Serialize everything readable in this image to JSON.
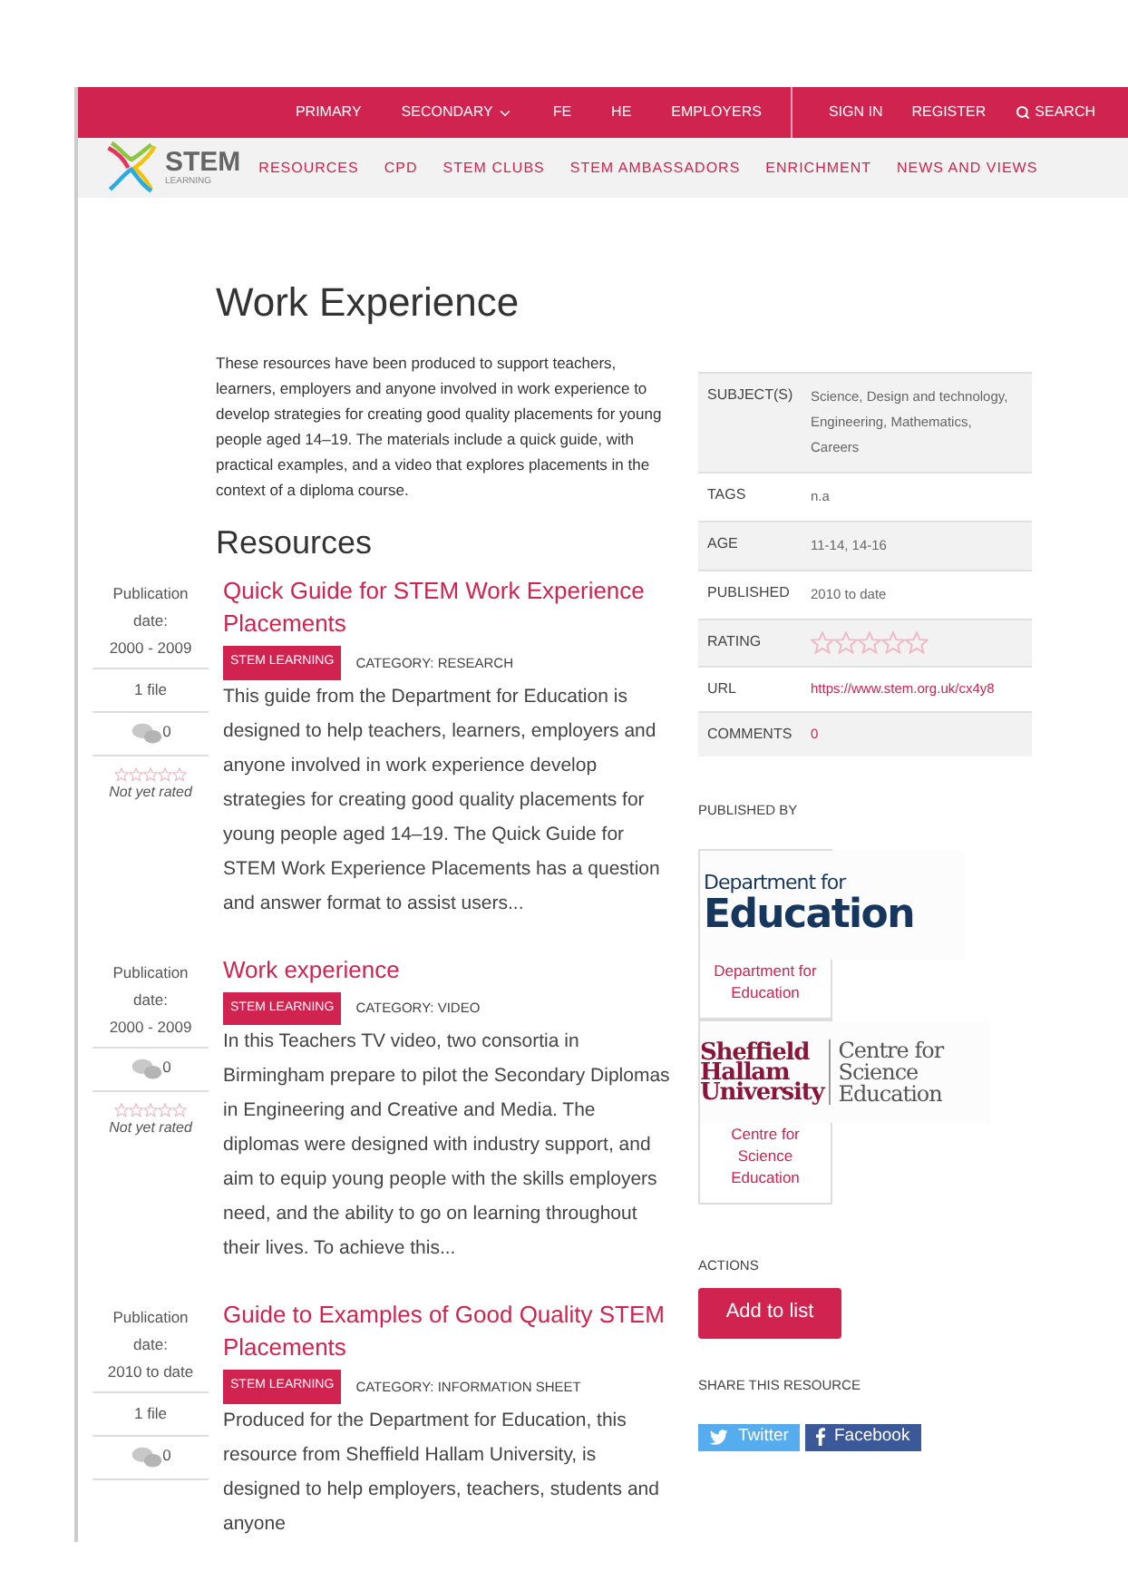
{
  "top_bar": {
    "links": [
      {
        "label": "PRIMARY",
        "dropdown": false
      },
      {
        "label": "SECONDARY",
        "dropdown": true
      },
      {
        "label": "FE",
        "dropdown": false
      },
      {
        "label": "HE",
        "dropdown": false
      },
      {
        "label": "EMPLOYERS",
        "dropdown": false
      }
    ],
    "account_links": [
      "SIGN IN",
      "REGISTER"
    ],
    "search": "SEARCH"
  },
  "logo": {
    "name": "STEM",
    "sub": "LEARNING"
  },
  "main_nav": [
    "RESOURCES",
    "CPD",
    "STEM CLUBS",
    "STEM AMBASSADORS",
    "ENRICHMENT",
    "NEWS AND VIEWS"
  ],
  "page_title": "Work Experience",
  "intro": "These resources have been produced to support teachers, learners, employers and anyone involved in work experience to develop strategies for creating good quality placements for young people aged 14–19. The materials include a quick guide, with practical examples, and a video that explores placements in the context of a diploma course.",
  "resources_heading": "Resources",
  "resources": [
    {
      "date_label": "Publication date:",
      "date": "2000 - 2009",
      "files": "1 file",
      "comments": "0",
      "stars": 0,
      "rating_text": "Not yet rated",
      "title": "Quick Guide for STEM Work Experience Placements",
      "badge": "STEM LEARNING",
      "category": "CATEGORY: RESEARCH",
      "description": "This guide from the Department for Education is designed to help teachers, learners, employers and anyone involved in work experience develop strategies for creating good quality placements for young people aged 14–19. The Quick Guide for STEM Work Experience Placements has a question and answer format to assist users..."
    },
    {
      "date_label": "Publication date:",
      "date": "2000 - 2009",
      "comments": "0",
      "stars": 0,
      "rating_text": "Not yet rated",
      "title": "Work experience",
      "badge": "STEM LEARNING",
      "category": "CATEGORY: VIDEO",
      "description": "In this Teachers TV video, two consortia in Birmingham prepare to pilot the Secondary Diplomas in Engineering and Creative and Media. The diplomas were designed with industry support, and aim to equip young people with the skills employers need, and the ability to go on learning throughout their lives. To achieve this..."
    },
    {
      "date_label": "Publication date:",
      "date": "2010 to date",
      "files": "1 file",
      "comments": "0",
      "title": "Guide to Examples of Good Quality STEM Placements",
      "badge": "STEM LEARNING",
      "category": "CATEGORY: INFORMATION SHEET",
      "description": "Produced for the Department for Education, this resource from Sheffield Hallam University, is designed to help employers, teachers, students and anyone"
    }
  ],
  "details": [
    {
      "kind": "text",
      "label": "SUBJECT(S)",
      "value": "Science, Design and technology, Engineering, Mathematics, Careers"
    },
    {
      "kind": "text",
      "label": "TAGS",
      "value": "n.a"
    },
    {
      "kind": "text",
      "label": "AGE",
      "value": "11-14, 14-16"
    },
    {
      "kind": "text",
      "label": "PUBLISHED",
      "value": "2010 to date"
    },
    {
      "kind": "stars",
      "label": "RATING",
      "stars": 0
    },
    {
      "kind": "link",
      "label": "URL",
      "value": "https://www.stem.org.uk/cx4y8"
    },
    {
      "kind": "link",
      "label": "COMMENTS",
      "value": "0"
    }
  ],
  "published_by": "PUBLISHED BY",
  "publishers": [
    {
      "kind": "dfe",
      "logo_lines": [
        "Department for",
        "Education"
      ],
      "name": "Department for Education"
    },
    {
      "kind": "shu",
      "logo_lines": [
        "Sheffield",
        "Hallam",
        "University"
      ],
      "logo_side": [
        "Centre for",
        "Science",
        "Education"
      ],
      "name": "Centre for Science Education"
    }
  ],
  "actions_label": "ACTIONS",
  "add_button": "Add to list",
  "share_label": "SHARE THIS RESOURCE",
  "share_buttons": [
    {
      "kind": "twitter",
      "label": "Twitter"
    },
    {
      "kind": "facebook",
      "label": "Facebook"
    }
  ]
}
